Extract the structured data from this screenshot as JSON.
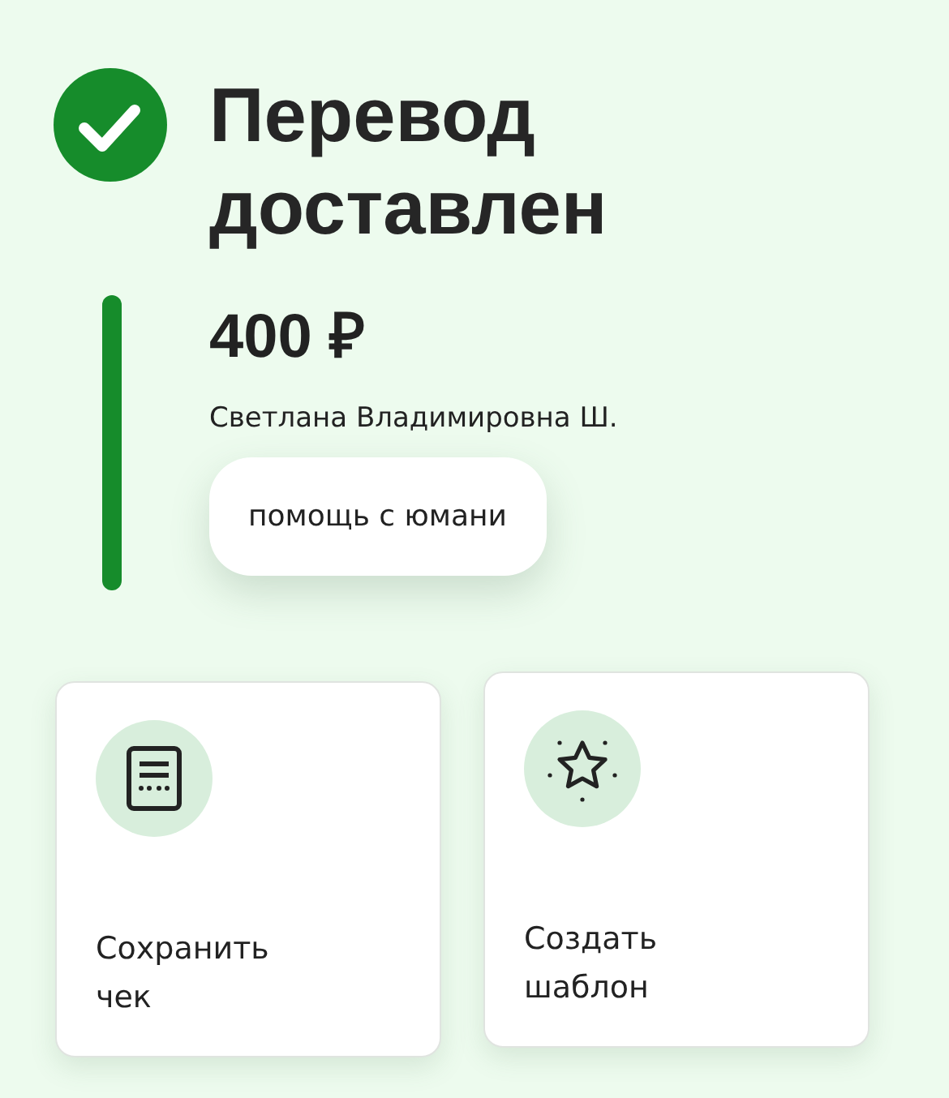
{
  "status": {
    "title": "Перевод доставлен",
    "done": true
  },
  "transfer": {
    "amount": "400 ₽",
    "recipient": "Светлана Владимировна Ш.",
    "comment": "помощь с юмани"
  },
  "actions": [
    {
      "kind": "receipt",
      "label": "Сохранить чек"
    },
    {
      "kind": "template",
      "label": "Создать шаблон"
    }
  ]
}
